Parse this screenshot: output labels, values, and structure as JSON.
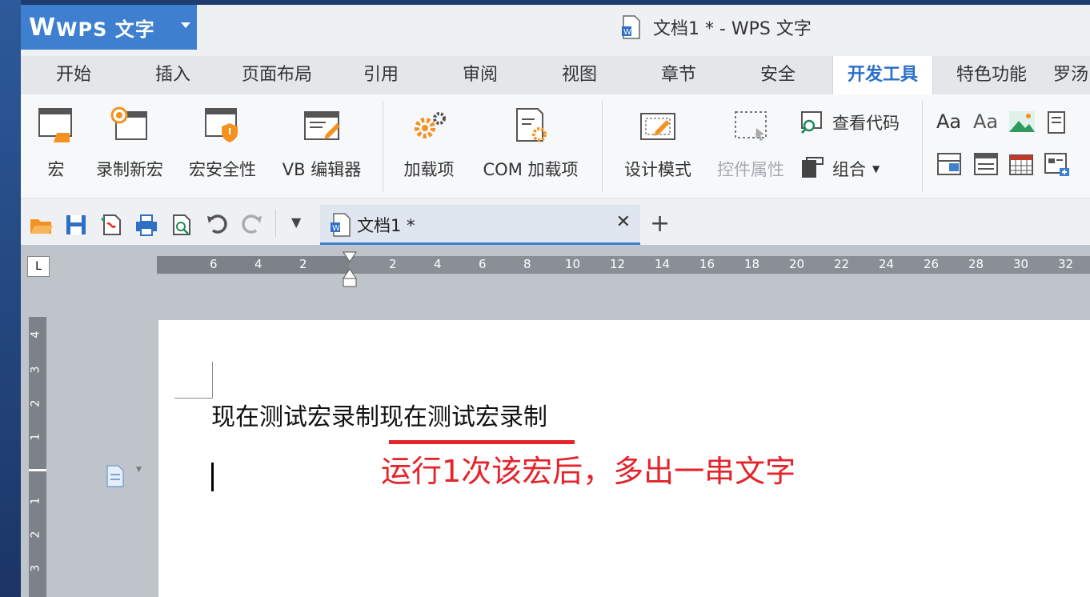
{
  "app": {
    "name": "WPS 文字",
    "logo_letter": "W"
  },
  "window": {
    "title": "文档1 * - WPS 文字"
  },
  "tabs": [
    {
      "label": "开始"
    },
    {
      "label": "插入"
    },
    {
      "label": "页面布局"
    },
    {
      "label": "引用"
    },
    {
      "label": "审阅"
    },
    {
      "label": "视图"
    },
    {
      "label": "章节"
    },
    {
      "label": "安全"
    },
    {
      "label": "开发工具"
    },
    {
      "label": "特色功能"
    },
    {
      "label": "罗汤"
    }
  ],
  "ribbon": {
    "macro": "宏",
    "record_macro": "录制新宏",
    "macro_security": "宏安全性",
    "vb_editor": "VB 编辑器",
    "addins": "加载项",
    "com_addins": "COM 加载项",
    "design_mode": "设计模式",
    "control_properties": "控件属性",
    "view_code": "查看代码",
    "group": "组合",
    "aa1": "Aa",
    "aa2": "Aa"
  },
  "doc_tab": {
    "label": "文档1 *"
  },
  "rulers": {
    "h_left": [
      "6",
      "4",
      "2"
    ],
    "h_right": [
      "2",
      "4",
      "6",
      "8",
      "10",
      "12",
      "14",
      "16",
      "18",
      "20",
      "22",
      "24",
      "26",
      "28",
      "30",
      "32"
    ],
    "v_top": [
      "4",
      "3",
      "2",
      "1"
    ],
    "v_bottom": [
      "1",
      "2",
      "3"
    ],
    "tab_marker": "L"
  },
  "document": {
    "line1": "现在测试宏录制现在测试宏录制"
  },
  "annotation": {
    "text": "运行1次该宏后，多出一串文字",
    "color": "#e4232a"
  },
  "colors": {
    "accent": "#3e7fd0",
    "active_tab_text": "#2a6fca"
  }
}
